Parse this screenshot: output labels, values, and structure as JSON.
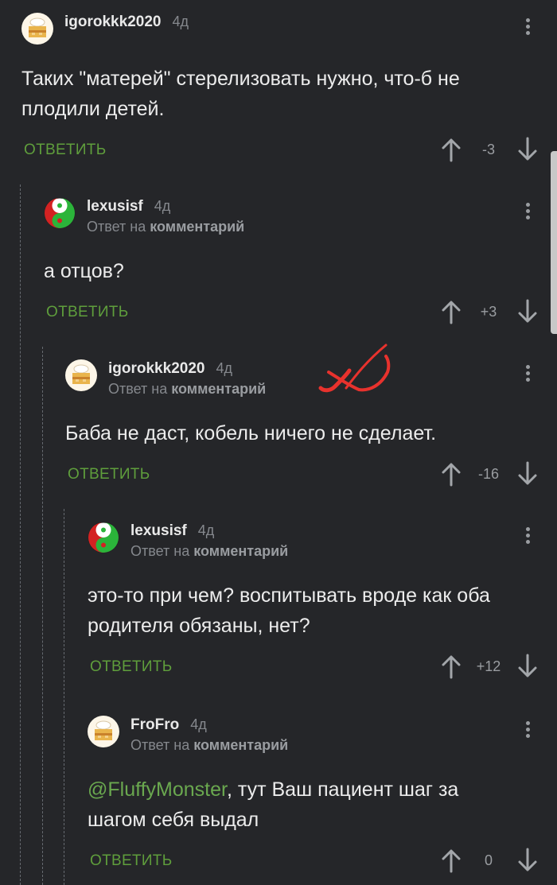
{
  "comments": [
    {
      "author": "igorokkk2020",
      "time": "4д",
      "reply_prefix": "",
      "reply_target": "",
      "text_pre": "",
      "mention": "",
      "text": "Таких \"матерей\" стерелизовать нужно, что-б не\nплодили детей.",
      "reply_label": "ОТВЕТИТЬ",
      "rating": "-3",
      "avatar": "cake-avatar"
    },
    {
      "author": "lexusisf",
      "time": "4д",
      "reply_prefix": "Ответ на ",
      "reply_target": "комментарий",
      "text_pre": "",
      "mention": "",
      "text": "а отцов?",
      "reply_label": "ОТВЕТИТЬ",
      "rating": "+3",
      "avatar": "yinyang-avatar"
    },
    {
      "author": "igorokkk2020",
      "time": "4д",
      "reply_prefix": "Ответ на ",
      "reply_target": "комментарий",
      "text_pre": "",
      "mention": "",
      "text": "Баба не даст, кобель ничего не сделает.",
      "reply_label": "ОТВЕТИТЬ",
      "rating": "-16",
      "avatar": "cake-avatar"
    },
    {
      "author": "lexusisf",
      "time": "4д",
      "reply_prefix": "Ответ на ",
      "reply_target": "комментарий",
      "text_pre": "",
      "mention": "",
      "text": "это-то при чем? воспитывать вроде как оба\nродителя обязаны, нет?",
      "reply_label": "ОТВЕТИТЬ",
      "rating": "+12",
      "avatar": "yinyang-avatar"
    },
    {
      "author": "FroFro",
      "time": "4д",
      "reply_prefix": "Ответ на ",
      "reply_target": "комментарий",
      "text_pre": "",
      "mention": "@FluffyMonster",
      "text": ", тут Ваш пациент шаг за\nшагом себя выдал",
      "reply_label": "ОТВЕТИТЬ",
      "rating": "0",
      "avatar": "cake-avatar"
    }
  ],
  "colors": {
    "background": "#252629",
    "reply_green": "#5f9e3c",
    "mention_green": "#6aa84f",
    "annotation_red": "#e8322d"
  }
}
